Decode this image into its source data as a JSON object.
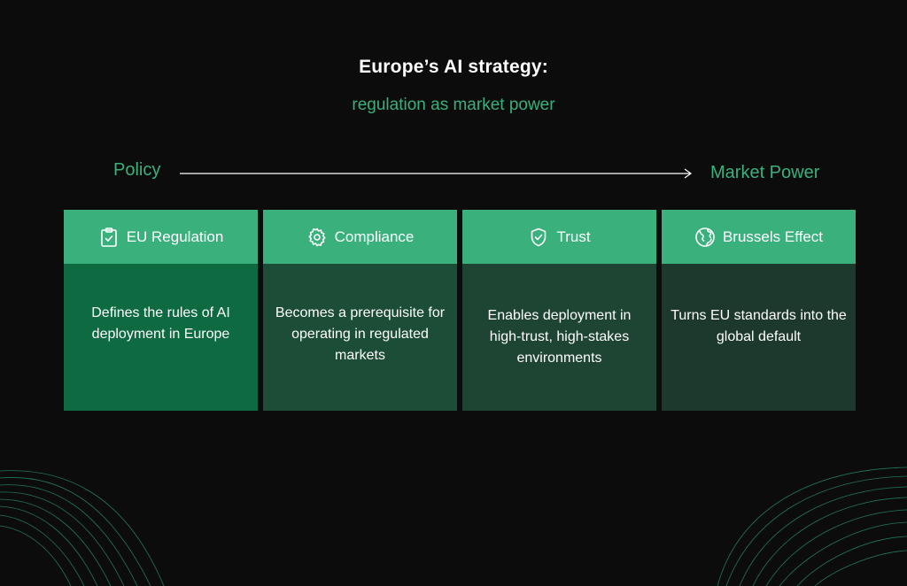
{
  "header": {
    "title": "Europe’s AI strategy:",
    "subtitle": "regulation as market power"
  },
  "flow": {
    "start_label": "Policy",
    "end_label": "Market Power"
  },
  "colors": {
    "background": "#0c0c0c",
    "accent": "#3ab07d",
    "card_head": "#3ab07d",
    "card_body_1": "#0e6a40",
    "card_body_2": "#1c4d37",
    "card_body_3": "#1e4433",
    "card_body_4": "#1d382c"
  },
  "cards": [
    {
      "title": "EU Regulation",
      "icon": "clipboard-check-icon",
      "text": "Defines the rules of AI deployment in Europe"
    },
    {
      "title": "Compliance",
      "icon": "gear-icon",
      "text": "Becomes a prerequisite for operating in regulated markets"
    },
    {
      "title": "Trust",
      "icon": "shield-check-icon",
      "text": "Enables deployment in high-trust, high-stakes environments"
    },
    {
      "title": "Brussels Effect",
      "icon": "globe-icon",
      "text": "Turns EU standards into the global default"
    }
  ]
}
